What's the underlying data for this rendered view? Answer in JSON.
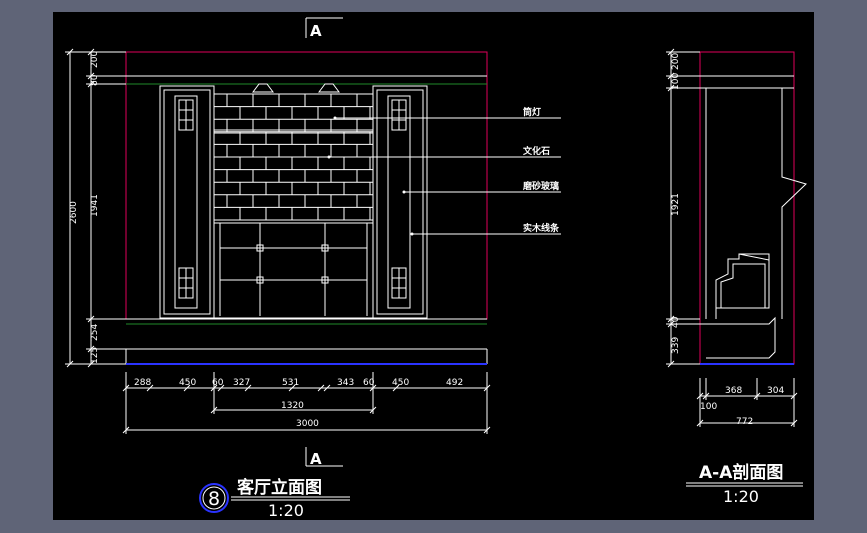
{
  "colors": {
    "screen": "#5f6477",
    "canvas": "#000000",
    "line": "#ffffff",
    "wall_boundary": "#e0005a",
    "floor": "#2a33ff",
    "ceiling_line": "#1f8a2a"
  },
  "section_marks": {
    "top": "A",
    "bottom": "A"
  },
  "callouts": [
    "筒灯",
    "文化石",
    "磨砂玻璃",
    "实木线条"
  ],
  "elevation": {
    "title": "客厅立面图",
    "scale": "1:20",
    "index": "8",
    "vertical_dims": [
      "200",
      "80",
      "1941",
      "2600",
      "254",
      "125"
    ],
    "horizontal_dims": [
      "288",
      "450",
      "60",
      "327",
      "531",
      "343",
      "60",
      "450",
      "492"
    ],
    "sub_total": "1320",
    "total": "3000"
  },
  "section": {
    "title": "A-A剖面图",
    "scale": "1:20",
    "vertical_dims": [
      "200",
      "100",
      "1921",
      "40",
      "339"
    ],
    "horizontal_dims": [
      "368",
      "304"
    ],
    "offset": "100",
    "total": "772"
  }
}
